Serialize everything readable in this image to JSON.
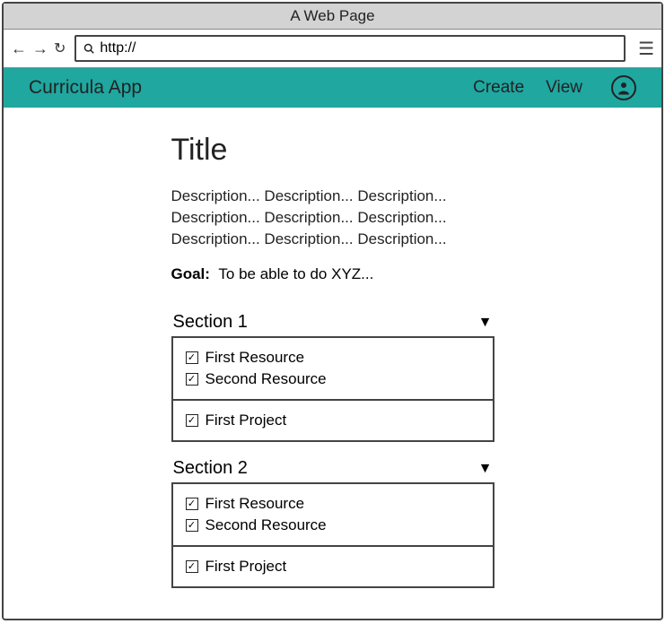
{
  "window": {
    "title": "A Web Page"
  },
  "browser": {
    "url_prefix": "http://"
  },
  "nav": {
    "brand": "Curricula App",
    "links": {
      "create": "Create",
      "view": "View"
    }
  },
  "page": {
    "title": "Title",
    "description": "Description... Description... Description... Description... Description... Description... Description... Description... Description...",
    "goal_label": "Goal:",
    "goal_text": "To be able to do XYZ..."
  },
  "sections": [
    {
      "title": "Section 1",
      "resources": [
        {
          "label": "First Resource",
          "checked": true
        },
        {
          "label": "Second Resource",
          "checked": true
        }
      ],
      "projects": [
        {
          "label": "First Project",
          "checked": true
        }
      ]
    },
    {
      "title": "Section 2",
      "resources": [
        {
          "label": "First Resource",
          "checked": true
        },
        {
          "label": "Second Resource",
          "checked": true
        }
      ],
      "projects": [
        {
          "label": "First Project",
          "checked": true
        }
      ]
    }
  ]
}
